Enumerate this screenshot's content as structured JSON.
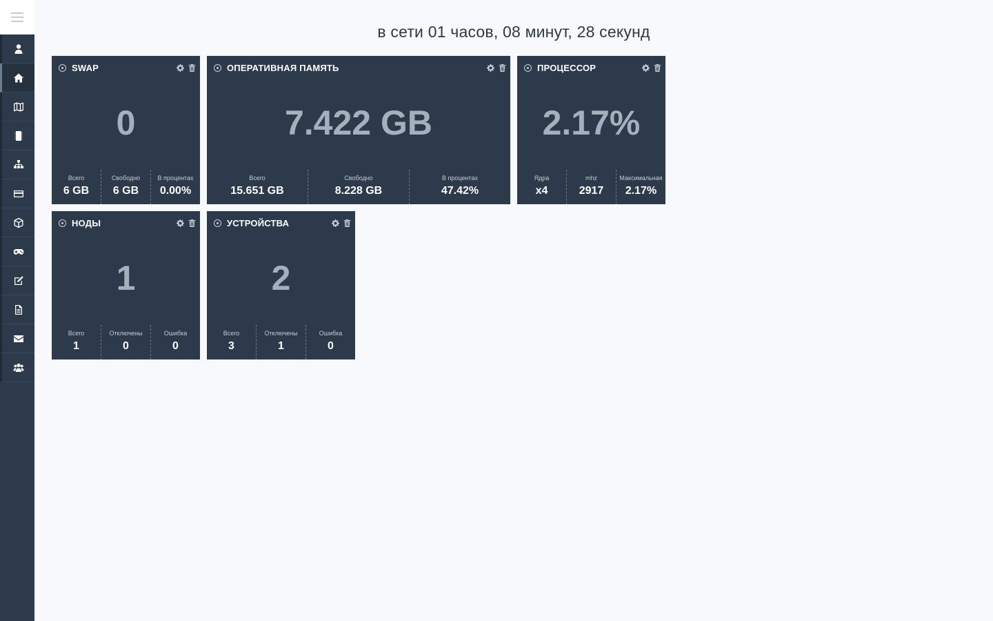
{
  "header": {
    "uptime": "в сети 01 часов, 08 минут, 28 секунд"
  },
  "sidebar": {
    "items": [
      {
        "icon": "user-icon"
      },
      {
        "icon": "home-icon",
        "active": true
      },
      {
        "icon": "map-icon"
      },
      {
        "icon": "memory-chip-icon"
      },
      {
        "icon": "sitemap-icon"
      },
      {
        "icon": "card-icon"
      },
      {
        "icon": "cube-icon"
      },
      {
        "icon": "gamepad-icon"
      },
      {
        "icon": "edit-icon"
      },
      {
        "icon": "document-icon"
      },
      {
        "icon": "envelope-icon"
      },
      {
        "icon": "users-icon"
      }
    ]
  },
  "widgets": {
    "swap": {
      "title": "SWAP",
      "value": "0",
      "stats": [
        {
          "label": "Всего",
          "value": "6 GB"
        },
        {
          "label": "Свободно",
          "value": "6 GB"
        },
        {
          "label": "В процентах",
          "value": "0.00%"
        }
      ]
    },
    "ram": {
      "title": "ОПЕРАТИВНАЯ ПАМЯТЬ",
      "value": "7.422 GB",
      "stats": [
        {
          "label": "Всего",
          "value": "15.651 GB"
        },
        {
          "label": "Свободно",
          "value": "8.228 GB"
        },
        {
          "label": "В процентах",
          "value": "47.42%"
        }
      ]
    },
    "cpu": {
      "title": "ПРОЦЕССОР",
      "value": "2.17%",
      "stats": [
        {
          "label": "Ядра",
          "value": "x4"
        },
        {
          "label": "mhz",
          "value": "2917"
        },
        {
          "label": "Максимальная",
          "value": "2.17%"
        }
      ]
    },
    "nodes": {
      "title": "НОДЫ",
      "value": "1",
      "stats": [
        {
          "label": "Всего",
          "value": "1"
        },
        {
          "label": "Отключены",
          "value": "0"
        },
        {
          "label": "Ошибка",
          "value": "0"
        }
      ]
    },
    "devices": {
      "title": "УСТРОЙСТВА",
      "value": "2",
      "stats": [
        {
          "label": "Всего",
          "value": "3"
        },
        {
          "label": "Отключены",
          "value": "1"
        },
        {
          "label": "Ошибка",
          "value": "0"
        }
      ]
    }
  },
  "colors": {
    "sidebar": "#2c3a4b",
    "widget": "#2c3a4b",
    "background": "#f7f9fc",
    "big_value": "#a5b0bd"
  }
}
